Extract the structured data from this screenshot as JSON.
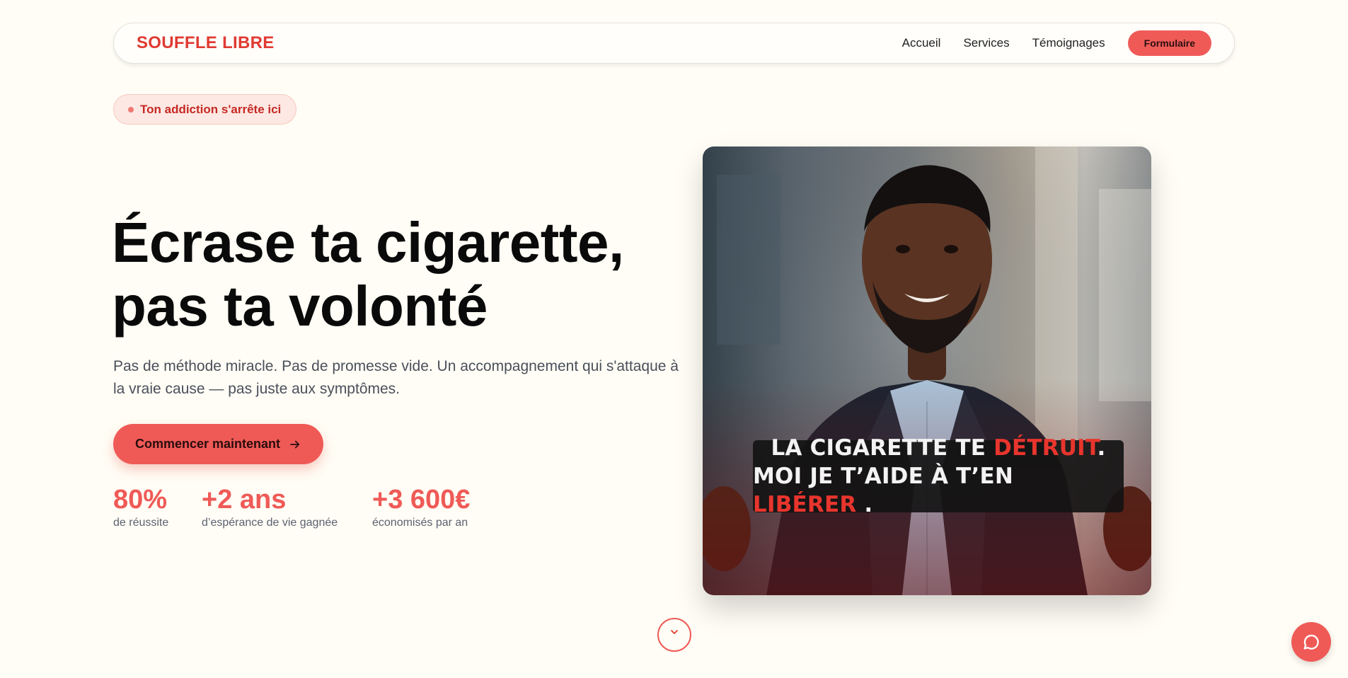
{
  "header": {
    "brand": "SOUFFLE LIBRE",
    "nav": [
      "Accueil",
      "Services",
      "Témoignages"
    ],
    "cta_label": "Formulaire"
  },
  "hero": {
    "badge": "Ton addiction s'arrête ici",
    "headline_line1": "Écrase ta cigarette,",
    "headline_line2": "pas ta volonté",
    "subtitle": "Pas de méthode miracle. Pas de promesse vide. Un accompagnement qui s'attaque à la vraie cause — pas juste aux symptômes.",
    "cta_label": "Commencer maintenant",
    "cta_icon": "arrow-right-icon"
  },
  "stats": [
    {
      "value": "80%",
      "label": "de réussite"
    },
    {
      "value": "+2 ans",
      "label": "d’espérance de vie gagnée"
    },
    {
      "value": "+3 600€",
      "label": "économisés par an"
    }
  ],
  "video": {
    "caption_line1_a": "LA CIGARETTE TE ",
    "caption_line1_b": "DÉTRUIT",
    "caption_line1_c": ".",
    "caption_line2_a": "MOI JE T’AIDE À T’EN ",
    "caption_line2_b": "LIBÉRER",
    "caption_line2_c": " ."
  },
  "icons": {
    "scroll": "chevron-down-icon",
    "chat": "chat-bubble-icon"
  },
  "colors": {
    "accent": "#ef5a57",
    "brand": "#e03a32",
    "background": "#fffdf5"
  }
}
